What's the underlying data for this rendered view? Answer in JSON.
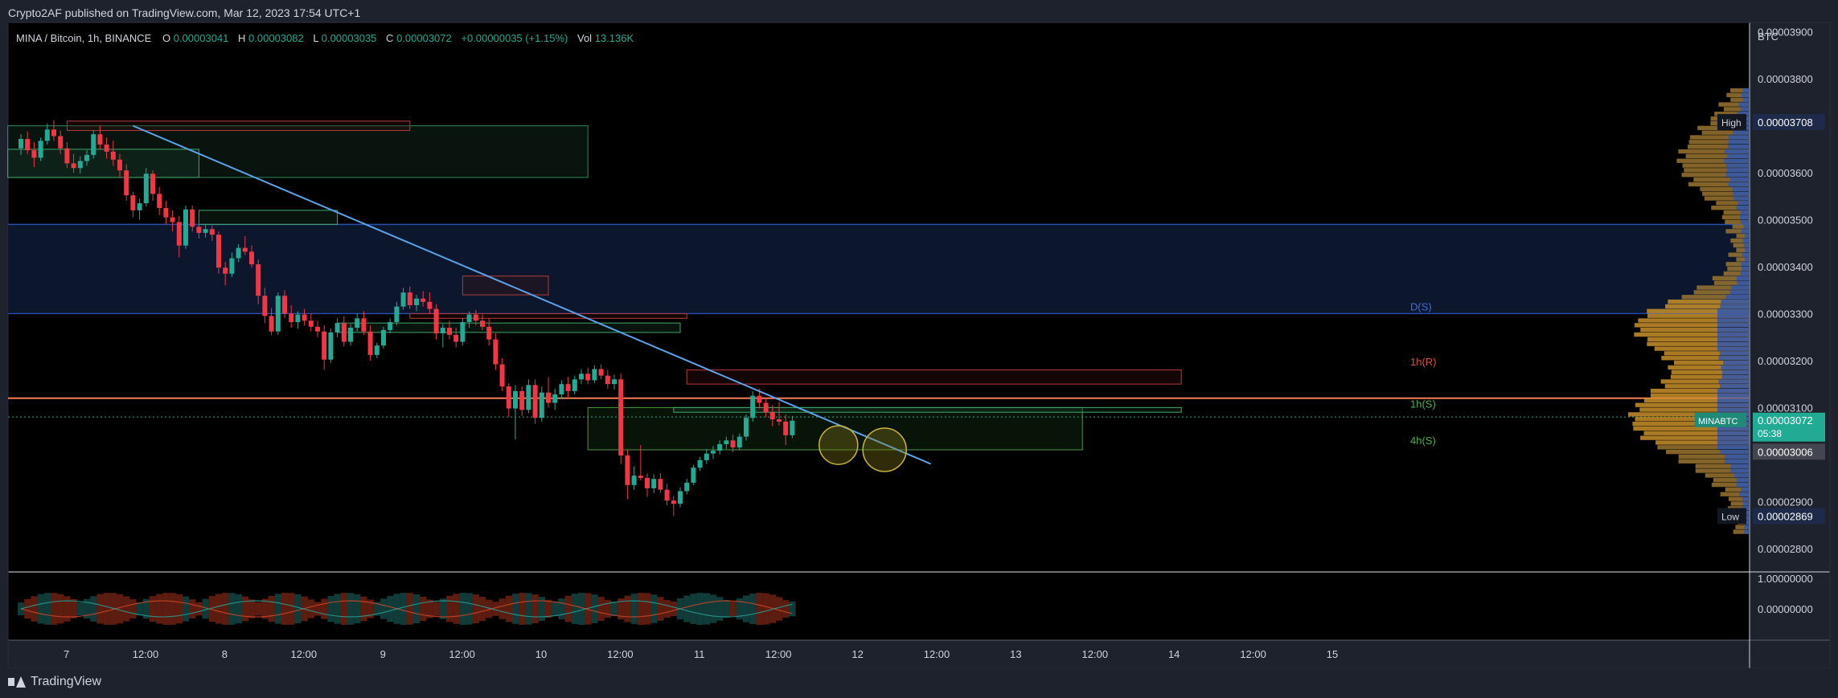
{
  "header": {
    "publisher": "Crypto2AF published on TradingView.com, Mar 12, 2023 17:54 UTC+1"
  },
  "footer": {
    "brand": "TradingView"
  },
  "colors": {
    "up": "#22ab94",
    "down": "#f23645",
    "trendline": "#5ba3e8",
    "resistance": "#f77c54",
    "zone_green": "#1a3a2a",
    "zone_blue": "#0d1a33",
    "profile_orange": "#c8902a",
    "profile_blue": "#2d56b4"
  },
  "chart_data": {
    "type": "candlestick",
    "symbol_line": {
      "symbol": "MINA / Bitcoin, 1h, BINANCE",
      "o_label": "O",
      "o": "0.00003041",
      "h_label": "H",
      "h": "0.00003082",
      "l_label": "L",
      "l": "0.00003035",
      "c_label": "C",
      "c": "0.00003072",
      "change": "+0.00000035 (+1.15%)",
      "vol_label": "Vol",
      "vol": "13.136K"
    },
    "currency": "BTC",
    "ylim": [
      2.75e-05,
      3.92e-05
    ],
    "y_ticks": [
      "0.00003900",
      "0.00003800",
      "0.00003600",
      "0.00003500",
      "0.00003400",
      "0.00003300",
      "0.00003200",
      "0.00003100",
      "0.00002900",
      "0.00002800"
    ],
    "x_ticks": [
      {
        "i": -9,
        "label": "12:00"
      },
      {
        "i": 3,
        "label": "7"
      },
      {
        "i": 15,
        "label": "12:00"
      },
      {
        "i": 27,
        "label": "8"
      },
      {
        "i": 39,
        "label": "12:00"
      },
      {
        "i": 51,
        "label": "9"
      },
      {
        "i": 63,
        "label": "12:00"
      },
      {
        "i": 75,
        "label": "10"
      },
      {
        "i": 87,
        "label": "12:00"
      },
      {
        "i": 99,
        "label": "11"
      },
      {
        "i": 111,
        "label": "12:00"
      },
      {
        "i": 123,
        "label": "12"
      },
      {
        "i": 135,
        "label": "12:00"
      },
      {
        "i": 147,
        "label": "13"
      },
      {
        "i": 159,
        "label": "12:00"
      },
      {
        "i": 171,
        "label": "14"
      },
      {
        "i": 183,
        "label": "12:00"
      },
      {
        "i": 195,
        "label": "15"
      }
    ],
    "price_labels": {
      "high_label": "High",
      "high": "0.00003708",
      "low_label": "Low",
      "low": "0.00002869",
      "symbol_tag": "MINABTC",
      "last": "0.00003072",
      "countdown": "05:38",
      "support_price": "0.00003006"
    },
    "level_labels": [
      {
        "text": "D(S)",
        "price": 3.3e-05
      },
      {
        "text": "1h(R)",
        "price": 3.183e-05
      },
      {
        "text": "1h(S)",
        "price": 3.093e-05
      },
      {
        "text": "4h(S)",
        "price": 3.015e-05
      }
    ],
    "oscillator": {
      "y_ticks": [
        "1.00000000",
        "0.00000000"
      ]
    },
    "candles": [
      [
        3.652e-05,
        3.682e-05,
        3.638e-05,
        3.672e-05
      ],
      [
        3.672e-05,
        3.688e-05,
        3.64e-05,
        3.648e-05
      ],
      [
        3.648e-05,
        3.665e-05,
        3.612e-05,
        3.632e-05
      ],
      [
        3.632e-05,
        3.675e-05,
        3.625e-05,
        3.668e-05
      ],
      [
        3.668e-05,
        3.705e-05,
        3.66e-05,
        3.692e-05
      ],
      [
        3.692e-05,
        3.712e-05,
        3.668e-05,
        3.678e-05
      ],
      [
        3.678e-05,
        3.69e-05,
        3.64e-05,
        3.652e-05
      ],
      [
        3.652e-05,
        3.665e-05,
        3.61e-05,
        3.62e-05
      ],
      [
        3.62e-05,
        3.64e-05,
        3.6e-05,
        3.61e-05
      ],
      [
        3.61e-05,
        3.635e-05,
        3.598e-05,
        3.625e-05
      ],
      [
        3.625e-05,
        3.648e-05,
        3.615e-05,
        3.638e-05
      ],
      [
        3.638e-05,
        3.69e-05,
        3.63e-05,
        3.682e-05
      ],
      [
        3.682e-05,
        3.7e-05,
        3.65e-05,
        3.66e-05
      ],
      [
        3.66e-05,
        3.675e-05,
        3.63e-05,
        3.645e-05
      ],
      [
        3.645e-05,
        3.668e-05,
        3.615e-05,
        3.628e-05
      ],
      [
        3.628e-05,
        3.64e-05,
        3.59e-05,
        3.605e-05
      ],
      [
        3.605e-05,
        3.618e-05,
        3.54e-05,
        3.552e-05
      ],
      [
        3.552e-05,
        3.56e-05,
        3.505e-05,
        3.52e-05
      ],
      [
        3.52e-05,
        3.545e-05,
        3.5e-05,
        3.535e-05
      ],
      [
        3.535e-05,
        3.61e-05,
        3.528e-05,
        3.598e-05
      ],
      [
        3.598e-05,
        3.605e-05,
        3.54e-05,
        3.555e-05
      ],
      [
        3.555e-05,
        3.57e-05,
        3.51e-05,
        3.525e-05
      ],
      [
        3.525e-05,
        3.54e-05,
        3.49e-05,
        3.505e-05
      ],
      [
        3.505e-05,
        3.52e-05,
        3.475e-05,
        3.495e-05
      ],
      [
        3.495e-05,
        3.508e-05,
        3.42e-05,
        3.445e-05
      ],
      [
        3.445e-05,
        3.53e-05,
        3.438e-05,
        3.522e-05
      ],
      [
        3.522e-05,
        3.53e-05,
        3.475e-05,
        3.485e-05
      ],
      [
        3.485e-05,
        3.498e-05,
        3.46e-05,
        3.472e-05
      ],
      [
        3.472e-05,
        3.49e-05,
        3.462e-05,
        3.48e-05
      ],
      [
        3.48e-05,
        3.488e-05,
        3.455e-05,
        3.468e-05
      ],
      [
        3.468e-05,
        3.475e-05,
        3.385e-05,
        3.398e-05
      ],
      [
        3.398e-05,
        3.41e-05,
        3.36e-05,
        3.385e-05
      ],
      [
        3.385e-05,
        3.43e-05,
        3.378e-05,
        3.418e-05
      ],
      [
        3.418e-05,
        3.448e-05,
        3.41e-05,
        3.44e-05
      ],
      [
        3.44e-05,
        3.465e-05,
        3.425e-05,
        3.432e-05
      ],
      [
        3.432e-05,
        3.445e-05,
        3.398e-05,
        3.405e-05
      ],
      [
        3.405e-05,
        3.415e-05,
        3.32e-05,
        3.338e-05
      ],
      [
        3.338e-05,
        3.355e-05,
        3.28e-05,
        3.295e-05
      ],
      [
        3.295e-05,
        3.312e-05,
        3.255e-05,
        3.262e-05
      ],
      [
        3.262e-05,
        3.345e-05,
        3.255e-05,
        3.338e-05
      ],
      [
        3.338e-05,
        3.35e-05,
        3.29e-05,
        3.3e-05
      ],
      [
        3.3e-05,
        3.318e-05,
        3.27e-05,
        3.282e-05
      ],
      [
        3.282e-05,
        3.305e-05,
        3.268e-05,
        3.298e-05
      ],
      [
        3.298e-05,
        3.31e-05,
        3.275e-05,
        3.285e-05
      ],
      [
        3.285e-05,
        3.3e-05,
        3.262e-05,
        3.272e-05
      ],
      [
        3.272e-05,
        3.285e-05,
        3.25e-05,
        3.262e-05
      ],
      [
        3.262e-05,
        3.275e-05,
        3.18e-05,
        3.202e-05
      ],
      [
        3.202e-05,
        3.268e-05,
        3.195e-05,
        3.26e-05
      ],
      [
        3.26e-05,
        3.29e-05,
        3.25e-05,
        3.28e-05
      ],
      [
        3.28e-05,
        3.295e-05,
        3.23e-05,
        3.24e-05
      ],
      [
        3.24e-05,
        3.278e-05,
        3.232e-05,
        3.27e-05
      ],
      [
        3.27e-05,
        3.3e-05,
        3.262e-05,
        3.29e-05
      ],
      [
        3.29e-05,
        3.305e-05,
        3.255e-05,
        3.262e-05
      ],
      [
        3.262e-05,
        3.275e-05,
        3.2e-05,
        3.212e-05
      ],
      [
        3.212e-05,
        3.238e-05,
        3.205e-05,
        3.232e-05
      ],
      [
        3.232e-05,
        3.272e-05,
        3.225e-05,
        3.265e-05
      ],
      [
        3.265e-05,
        3.29e-05,
        3.258e-05,
        3.282e-05
      ],
      [
        3.282e-05,
        3.325e-05,
        3.275e-05,
        3.315e-05
      ],
      [
        3.315e-05,
        3.355e-05,
        3.308e-05,
        3.345e-05
      ],
      [
        3.345e-05,
        3.358e-05,
        3.31e-05,
        3.318e-05
      ],
      [
        3.318e-05,
        3.34e-05,
        3.305e-05,
        3.332e-05
      ],
      [
        3.332e-05,
        3.348e-05,
        3.315e-05,
        3.325e-05
      ],
      [
        3.325e-05,
        3.345e-05,
        3.3e-05,
        3.31e-05
      ],
      [
        3.31e-05,
        3.32e-05,
        3.245e-05,
        3.258e-05
      ],
      [
        3.258e-05,
        3.278e-05,
        3.228e-05,
        3.27e-05
      ],
      [
        3.27e-05,
        3.285e-05,
        3.245e-05,
        3.255e-05
      ],
      [
        3.255e-05,
        3.27e-05,
        3.228e-05,
        3.24e-05
      ],
      [
        3.24e-05,
        3.29e-05,
        3.232e-05,
        3.282e-05
      ],
      [
        3.282e-05,
        3.305e-05,
        3.27e-05,
        3.298e-05
      ],
      [
        3.298e-05,
        3.308e-05,
        3.275e-05,
        3.285e-05
      ],
      [
        3.285e-05,
        3.298e-05,
        3.265e-05,
        3.272e-05
      ],
      [
        3.272e-05,
        3.29e-05,
        3.232e-05,
        3.245e-05
      ],
      [
        3.245e-05,
        3.258e-05,
        3.18e-05,
        3.192e-05
      ],
      [
        3.192e-05,
        3.205e-05,
        3.135e-05,
        3.145e-05
      ],
      [
        3.145e-05,
        3.152e-05,
        3.08e-05,
        3.098e-05
      ],
      [
        3.098e-05,
        3.148e-05,
        3.032e-05,
        3.135e-05
      ],
      [
        3.135e-05,
        3.145e-05,
        3.082e-05,
        3.095e-05
      ],
      [
        3.095e-05,
        3.16e-05,
        3.088e-05,
        3.148e-05
      ],
      [
        3.148e-05,
        3.16e-05,
        3.065e-05,
        3.078e-05
      ],
      [
        3.078e-05,
        3.145e-05,
        3.07e-05,
        3.132e-05
      ],
      [
        3.132e-05,
        3.165e-05,
        3.1e-05,
        3.11e-05
      ],
      [
        3.11e-05,
        3.14e-05,
        3.095e-05,
        3.128e-05
      ],
      [
        3.128e-05,
        3.158e-05,
        3.118e-05,
        3.15e-05
      ],
      [
        3.15e-05,
        3.165e-05,
        3.12e-05,
        3.135e-05
      ],
      [
        3.135e-05,
        3.168e-05,
        3.128e-05,
        3.16e-05
      ],
      [
        3.16e-05,
        3.182e-05,
        3.15e-05,
        3.172e-05
      ],
      [
        3.172e-05,
        3.185e-05,
        3.15e-05,
        3.158e-05
      ],
      [
        3.158e-05,
        3.19e-05,
        3.152e-05,
        3.182e-05
      ],
      [
        3.182e-05,
        3.192e-05,
        3.16e-05,
        3.168e-05
      ],
      [
        3.168e-05,
        3.18e-05,
        3.14e-05,
        3.15e-05
      ],
      [
        3.15e-05,
        3.17e-05,
        3.138e-05,
        3.16e-05
      ],
      [
        3.16e-05,
        3.172e-05,
        2.98e-05,
        2.998e-05
      ],
      [
        2.998e-05,
        3.01e-05,
        2.905e-05,
        2.935e-05
      ],
      [
        2.935e-05,
        2.975e-05,
        2.925e-05,
        2.955e-05
      ],
      [
        2.955e-05,
        3.02e-05,
        2.945e-05,
        2.95e-05
      ],
      [
        2.95e-05,
        2.96e-05,
        2.91e-05,
        2.928e-05
      ],
      [
        2.928e-05,
        2.958e-05,
        2.918e-05,
        2.948e-05
      ],
      [
        2.948e-05,
        2.96e-05,
        2.918e-05,
        2.925e-05
      ],
      [
        2.925e-05,
        2.938e-05,
        2.892e-05,
        2.902e-05
      ],
      [
        2.902e-05,
        2.912e-05,
        2.869e-05,
        2.895e-05
      ],
      [
        2.895e-05,
        2.93e-05,
        2.888e-05,
        2.922e-05
      ],
      [
        2.922e-05,
        2.948e-05,
        2.915e-05,
        2.94e-05
      ],
      [
        2.94e-05,
        2.978e-05,
        2.935e-05,
        2.972e-05
      ],
      [
        2.972e-05,
        2.995e-05,
        2.965e-05,
        2.988e-05
      ],
      [
        2.988e-05,
        3.012e-05,
        2.98e-05,
        3.002e-05
      ],
      [
        3.002e-05,
        3.018e-05,
        2.99e-05,
        3.008e-05
      ],
      [
        3.008e-05,
        3.03e-05,
        3e-05,
        3.022e-05
      ],
      [
        3.022e-05,
        3.038e-05,
        3.012e-05,
        3.03e-05
      ],
      [
        3.03e-05,
        3.042e-05,
        3.005e-05,
        3.015e-05
      ],
      [
        3.015e-05,
        3.045e-05,
        3.01e-05,
        3.038e-05
      ],
      [
        3.038e-05,
        3.085e-05,
        3.03e-05,
        3.078e-05
      ],
      [
        3.078e-05,
        3.135e-05,
        3.07e-05,
        3.125e-05
      ],
      [
        3.125e-05,
        3.14e-05,
        3.098e-05,
        3.11e-05
      ],
      [
        3.11e-05,
        3.12e-05,
        3.08e-05,
        3.09e-05
      ],
      [
        3.09e-05,
        3.105e-05,
        3.06e-05,
        3.075e-05
      ],
      [
        3.075e-05,
        3.112e-05,
        3.062e-05,
        3.07e-05
      ],
      [
        3.07e-05,
        3.085e-05,
        3.02e-05,
        3.041e-05
      ],
      [
        3.041e-05,
        3.082e-05,
        3.035e-05,
        3.072e-05
      ]
    ]
  }
}
